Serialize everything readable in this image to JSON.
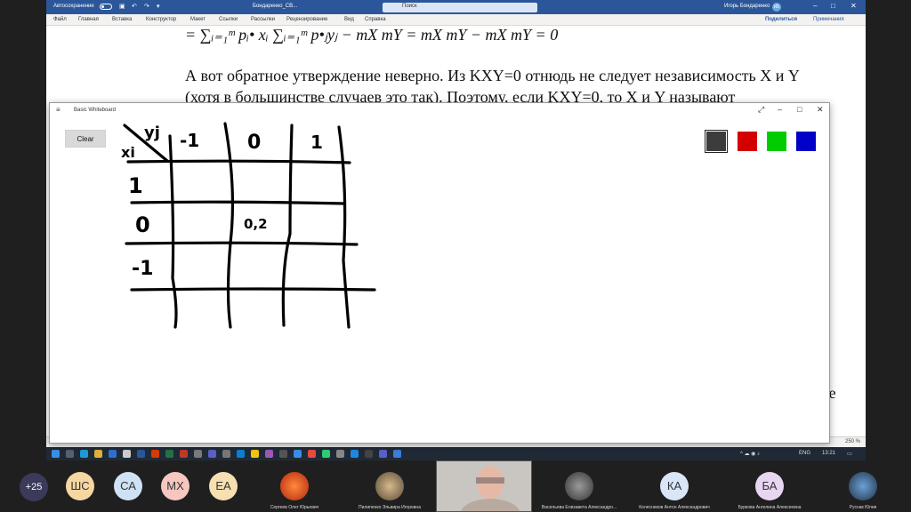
{
  "word": {
    "autosave_label": "Автосохранение",
    "doc_title": "Бондаренко_СВ...",
    "search_placeholder": "Поиск",
    "user_name": "Игорь Бондаренко",
    "user_initials": "ИБ",
    "tabs": [
      "Файл",
      "Главная",
      "Вставка",
      "Конструктор",
      "Макет",
      "Ссылки",
      "Рассылки",
      "Рецензирование",
      "Вид",
      "Справка"
    ],
    "share_label": "Поделиться",
    "notes_label": "Примечания",
    "zoom": "250 %"
  },
  "document": {
    "formula": "= ∑ᵢ₌₁ᵐ pᵢ• xᵢ ∑ᵢ₌₁ᵐ p•ⱼyⱼ − mX mY = mX mY − mX mY = 0",
    "line1": "А вот обратное утверждение неверно. Из KXY=0  отнюдь не следует независимость X и Y",
    "line2": "(хотя в большинстве случаев это так). Поэтому, если KXY=0, то X и Y  называют",
    "edge_text": "ие"
  },
  "whiteboard": {
    "title": "Basic Whiteboard",
    "clear_label": "Clear",
    "colors": [
      {
        "name": "dark-gray",
        "hex": "#3c3c3c",
        "selected": true
      },
      {
        "name": "red",
        "hex": "#d40000",
        "selected": false
      },
      {
        "name": "green",
        "hex": "#00cc00",
        "selected": false
      },
      {
        "name": "blue",
        "hex": "#0000c8",
        "selected": false
      }
    ],
    "handwriting": {
      "header_y": "yj",
      "header_x": "xi",
      "col_labels": [
        "-1",
        "0",
        "1"
      ],
      "row_labels": [
        "1",
        "0",
        "-1"
      ],
      "cell_value": "0,2"
    }
  },
  "taskbar": {
    "lang": "ENG",
    "time": "13:21"
  },
  "participants": {
    "more_count": "+25",
    "initials": [
      {
        "initials": "ШС",
        "color": "#f6d7a2"
      },
      {
        "initials": "СА",
        "color": "#cfe2f5"
      },
      {
        "initials": "МХ",
        "color": "#f6c7c0"
      },
      {
        "initials": "ЕА",
        "color": "#f6dfb0"
      }
    ],
    "video": [
      {
        "name": "Сергеев Олег Юрьевич"
      },
      {
        "name": "Пилипенко Эльвира Игоревна"
      },
      {
        "name": ""
      },
      {
        "name": "Васильева Елизавета Александро..."
      }
    ],
    "more_initials": [
      {
        "initials": "КА",
        "color": "#d9e6f7",
        "name": "Колесников Антон Александрович"
      },
      {
        "initials": "БА",
        "color": "#e8d6f0",
        "name": "Буркова Ангелина Алексеевна"
      }
    ],
    "last_name": "Руснак Юлия"
  }
}
